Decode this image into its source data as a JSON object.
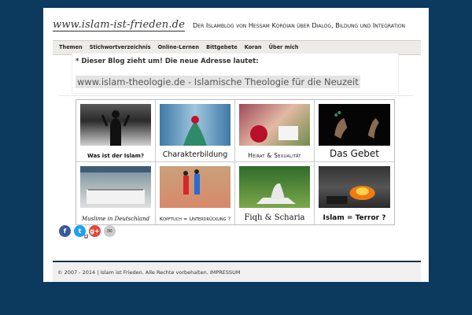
{
  "header": {
    "logo": "www.islam-ist-frieden.de",
    "tagline": "Der Islamblog von Hessam Kordian über Dialog, Bildung und Integration"
  },
  "nav": {
    "items": [
      {
        "label": "Themen"
      },
      {
        "label": "Stichwortverzeichnis"
      },
      {
        "label": "Online-Lernen"
      },
      {
        "label": "Bittgebete"
      },
      {
        "label": "Koran"
      },
      {
        "label": "Über mich"
      }
    ]
  },
  "notice": {
    "title": "* Dieser Blog zieht um! Die neue Adresse lautet:",
    "link": "www.islam-theologie.de - Islamische Theologie für die Neuzeit"
  },
  "tiles": [
    {
      "label": "Was ist der Islam?"
    },
    {
      "label": "Charakterbildung"
    },
    {
      "label": "Heirat & Sexualität"
    },
    {
      "label": "Das Gebet"
    },
    {
      "label": "Muslime in Deutschland"
    },
    {
      "label": "Kopftuch = Unterdrückung ?"
    },
    {
      "label": "Fiqh & Scharia"
    },
    {
      "label": "Islam = Terror ?"
    }
  ],
  "share": {
    "facebook": "f",
    "twitter": "t",
    "twitter_count": "1",
    "googleplus": "g+",
    "email": "✉"
  },
  "footer": {
    "text": "© 2007 - 2014 | Islam ist Frieden. Alle Rechte vorbehalten. IMPRESSUM"
  },
  "colors": {
    "background": "#0b3a5e",
    "facebook": "#3b5998",
    "twitter": "#1da1f2",
    "googleplus": "#dd4b39",
    "email": "#cccccc"
  }
}
